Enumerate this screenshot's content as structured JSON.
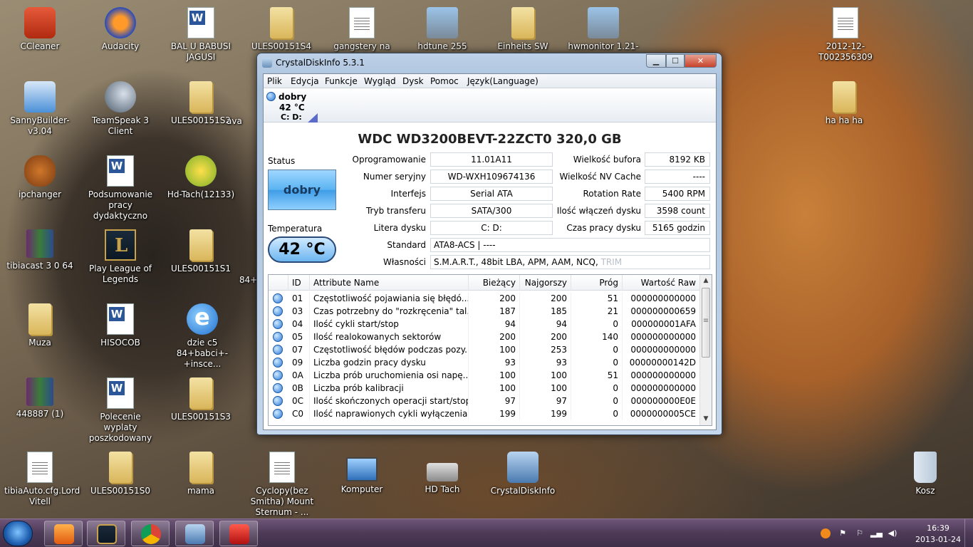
{
  "desktop": {
    "icons": [
      {
        "label": "CCleaner"
      },
      {
        "label": "Audacity"
      },
      {
        "label": "BAL U BABUSI JAGUSI"
      },
      {
        "label": "ULES00151S4"
      },
      {
        "label": "gangstery na valahar"
      },
      {
        "label": "hdtune 255"
      },
      {
        "label": "Einheits SW Mod"
      },
      {
        "label": "hwmonitor 1.21-s..."
      },
      {
        "label": "2012-12-T002356309"
      },
      {
        "label": "SannyBuilder-v3.04"
      },
      {
        "label": "TeamSpeak 3 Client"
      },
      {
        "label": "ULES00151S2"
      },
      {
        "label": "ava"
      },
      {
        "label": "ha ha ha"
      },
      {
        "label": "ipchanger"
      },
      {
        "label": "Podsumowanie pracy dydaktyczno"
      },
      {
        "label": "Hd-Tach(12133)"
      },
      {
        "label": "tibiacast 3 0 64"
      },
      {
        "label": "Play League of Legends"
      },
      {
        "label": "ULES00151S1"
      },
      {
        "label": "84+"
      },
      {
        "label": "Muza"
      },
      {
        "label": "HISOCOB"
      },
      {
        "label": "dzie c5 84+babci+-+insce..."
      },
      {
        "label": "448887 (1)"
      },
      {
        "label": "Polecenie wyplaty poszkodowany"
      },
      {
        "label": "ULES00151S3"
      },
      {
        "label": "tibiaAuto.cfg.Lord Vitell"
      },
      {
        "label": "ULES00151S0"
      },
      {
        "label": "mama"
      },
      {
        "label": "Cyclopy(bez Smitha) Mount Sternum - ..."
      },
      {
        "label": "Komputer"
      },
      {
        "label": "HD Tach"
      },
      {
        "label": "CrystalDiskInfo"
      },
      {
        "label": "Kosz"
      }
    ]
  },
  "window": {
    "title": "CrystalDiskInfo 5.3.1",
    "menu": [
      "Plik",
      "Edycja",
      "Funkcje",
      "Wygląd",
      "Dysk",
      "Pomoc",
      "Język(Language)"
    ],
    "disk_tab": {
      "health": "dobry",
      "temp": "42 °C",
      "letter": "C: D:"
    },
    "model": "WDC WD3200BEVT-22ZCT0  320,0 GB",
    "status_label": "Status",
    "status_value": "dobry",
    "temp_label": "Temperatura",
    "temp_value": "42 °C",
    "left_fields": [
      {
        "label": "Oprogramowanie",
        "value": "11.01A11"
      },
      {
        "label": "Numer seryjny",
        "value": "WD-WXH109674136"
      },
      {
        "label": "Interfejs",
        "value": "Serial ATA"
      },
      {
        "label": "Tryb transferu",
        "value": "SATA/300"
      },
      {
        "label": "Litera dysku",
        "value": "C: D:"
      }
    ],
    "right_fields": [
      {
        "label": "Wielkość bufora",
        "value": "8192 KB"
      },
      {
        "label": "Wielkość NV Cache",
        "value": "----"
      },
      {
        "label": "Rotation Rate",
        "value": "5400 RPM"
      },
      {
        "label": "Ilość włączeń dysku",
        "value": "3598 count"
      },
      {
        "label": "Czas pracy dysku",
        "value": "5165 godzin"
      }
    ],
    "standard": {
      "label": "Standard",
      "value": "ATA8-ACS | ----"
    },
    "features": {
      "label": "Własności",
      "value": "S.M.A.R.T., 48bit LBA, APM, AAM, NCQ,",
      "disabled": "TRIM"
    },
    "table": {
      "headers": [
        "ID",
        "Attribute Name",
        "Bieżący",
        "Najgorszy",
        "Próg",
        "Wartość Raw"
      ],
      "rows": [
        {
          "id": "01",
          "name": "Częstotliwość pojawiania się błędó...",
          "cur": "200",
          "worst": "200",
          "thr": "51",
          "raw": "000000000000"
        },
        {
          "id": "03",
          "name": "Czas potrzebny do \"rozkręcenia\" tal...",
          "cur": "187",
          "worst": "185",
          "thr": "21",
          "raw": "000000000659"
        },
        {
          "id": "04",
          "name": "Ilość cykli start/stop",
          "cur": "94",
          "worst": "94",
          "thr": "0",
          "raw": "000000001AFA"
        },
        {
          "id": "05",
          "name": "Ilość realokowanych sektorów",
          "cur": "200",
          "worst": "200",
          "thr": "140",
          "raw": "000000000000"
        },
        {
          "id": "07",
          "name": "Częstotliwość błędów podczas pozy...",
          "cur": "100",
          "worst": "253",
          "thr": "0",
          "raw": "000000000000"
        },
        {
          "id": "09",
          "name": "Liczba godzin pracy dysku",
          "cur": "93",
          "worst": "93",
          "thr": "0",
          "raw": "00000000142D"
        },
        {
          "id": "0A",
          "name": "Liczba prób uruchomienia osi napę...",
          "cur": "100",
          "worst": "100",
          "thr": "51",
          "raw": "000000000000"
        },
        {
          "id": "0B",
          "name": "Liczba prób kalibracji",
          "cur": "100",
          "worst": "100",
          "thr": "0",
          "raw": "000000000000"
        },
        {
          "id": "0C",
          "name": "Ilość skończonych operacji start/stop",
          "cur": "97",
          "worst": "97",
          "thr": "0",
          "raw": "000000000E0E"
        },
        {
          "id": "C0",
          "name": "Ilość naprawionych cykli wyłączenia",
          "cur": "199",
          "worst": "199",
          "thr": "0",
          "raw": "0000000005CE"
        }
      ]
    }
  },
  "taskbar": {
    "clock_time": "16:39",
    "clock_date": "2013-01-24"
  }
}
